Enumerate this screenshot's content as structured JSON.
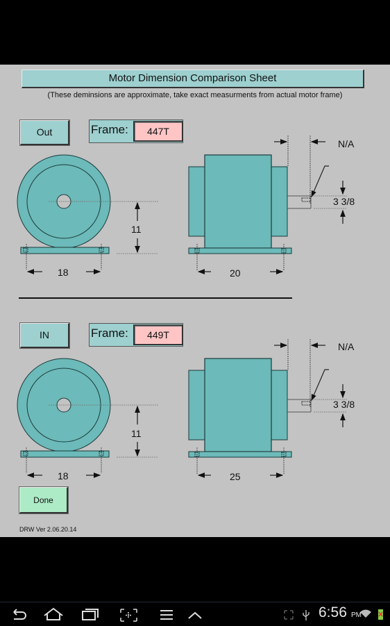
{
  "header": {
    "title": "Motor Dimension Comparison Sheet",
    "subtitle": "(These deminsions are approximate, take exact measurments from actual motor frame)"
  },
  "motors": [
    {
      "role_button_label": "Out",
      "frame_label": "Frame:",
      "frame_value": "447T",
      "dims": {
        "shaft_height": "11",
        "foot_width": "18",
        "foot_length": "20",
        "shaft_extension": "N/A",
        "shaft_diameter": "3 3/8"
      }
    },
    {
      "role_button_label": "IN",
      "frame_label": "Frame:",
      "frame_value": "449T",
      "dims": {
        "shaft_height": "11",
        "foot_width": "18",
        "foot_length": "25",
        "shaft_extension": "N/A",
        "shaft_diameter": "3 3/8"
      }
    }
  ],
  "footer": {
    "done_label": "Done",
    "version": "DRW Ver 2.06.20.14"
  },
  "system_bar": {
    "time": "6:56",
    "ampm": "PM",
    "icons": [
      "back-icon",
      "home-icon",
      "recent-apps-icon",
      "screenshot-icon",
      "menu-icon",
      "up-chevron-icon",
      "fullscreen-icon",
      "usb-icon",
      "wifi-icon",
      "battery-icon"
    ]
  },
  "colors": {
    "motor_teal": "#6cbab9",
    "button_teal": "#9dd0cf",
    "frame_value_pink": "#ffc5c5",
    "done_green": "#acebc6",
    "background_gray": "#c3c3c3"
  }
}
